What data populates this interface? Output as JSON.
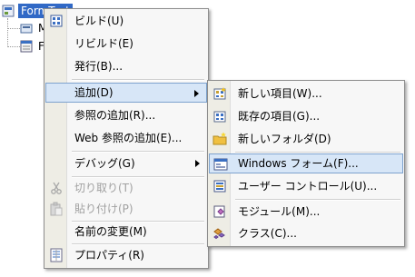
{
  "tree": {
    "root_label": "FormTest",
    "items": [
      {
        "label": "M",
        "icon": "reference-folder-icon"
      },
      {
        "label": "F",
        "icon": "form-file-icon"
      }
    ]
  },
  "context_menu": {
    "items": [
      {
        "label": "ビルド(U)",
        "icon": "build-icon"
      },
      {
        "label": "リビルド(E)"
      },
      {
        "label": "発行(B)..."
      },
      {
        "label": "追加(D)"
      },
      {
        "label": "参照の追加(R)..."
      },
      {
        "label": "Web 参照の追加(E)..."
      },
      {
        "label": "デバッグ(G)"
      },
      {
        "label": "切り取り(T)",
        "icon": "cut-icon"
      },
      {
        "label": "貼り付け(P)",
        "icon": "paste-icon"
      },
      {
        "label": "名前の変更(M)"
      },
      {
        "label": "プロパティ(R)",
        "icon": "properties-icon"
      }
    ]
  },
  "submenu": {
    "items": [
      {
        "label": "新しい項目(W)...",
        "icon": "new-item-icon"
      },
      {
        "label": "既存の項目(G)...",
        "icon": "existing-item-icon"
      },
      {
        "label": "新しいフォルダ(D)",
        "icon": "new-folder-icon"
      },
      {
        "label": "Windows フォーム(F)...",
        "icon": "windows-form-icon"
      },
      {
        "label": "ユーザー コントロール(U)...",
        "icon": "user-control-icon"
      },
      {
        "label": "モジュール(M)...",
        "icon": "module-icon"
      },
      {
        "label": "クラス(C)...",
        "icon": "class-icon"
      }
    ]
  }
}
